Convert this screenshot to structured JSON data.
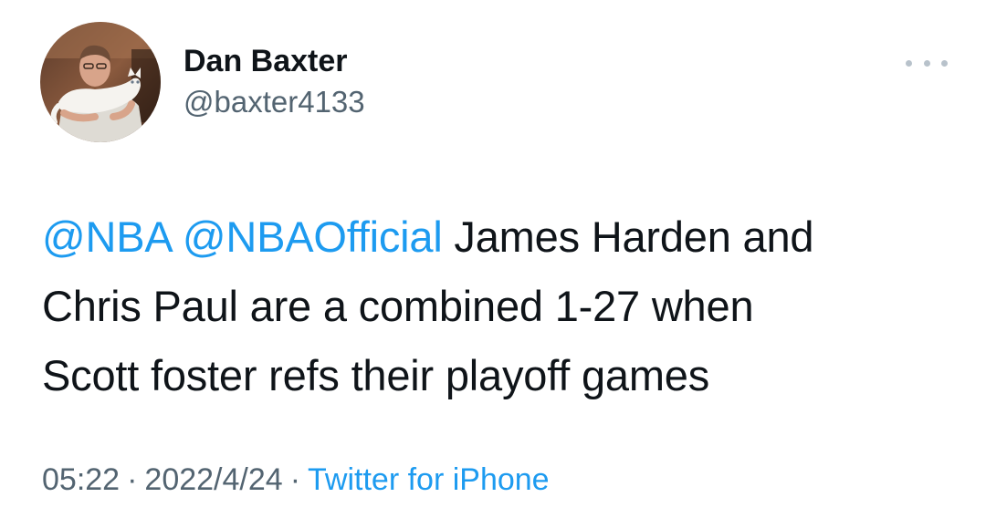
{
  "user": {
    "display_name": "Dan Baxter",
    "handle": "@baxter4133"
  },
  "more_icon": "ellipsis-icon",
  "tweet": {
    "mentions": [
      "@NBA",
      "@NBAOfficial"
    ],
    "text_line1": " James Harden and",
    "text_line2": "Chris Paul are a combined 1-27 when",
    "text_line3": "Scott foster refs their playoff games"
  },
  "meta": {
    "time": "05:22",
    "separator": "·",
    "date": "2022/4/24",
    "source": "Twitter for iPhone"
  },
  "colors": {
    "link": "#1d9bf0",
    "text": "#0f1419",
    "secondary": "#536471"
  }
}
